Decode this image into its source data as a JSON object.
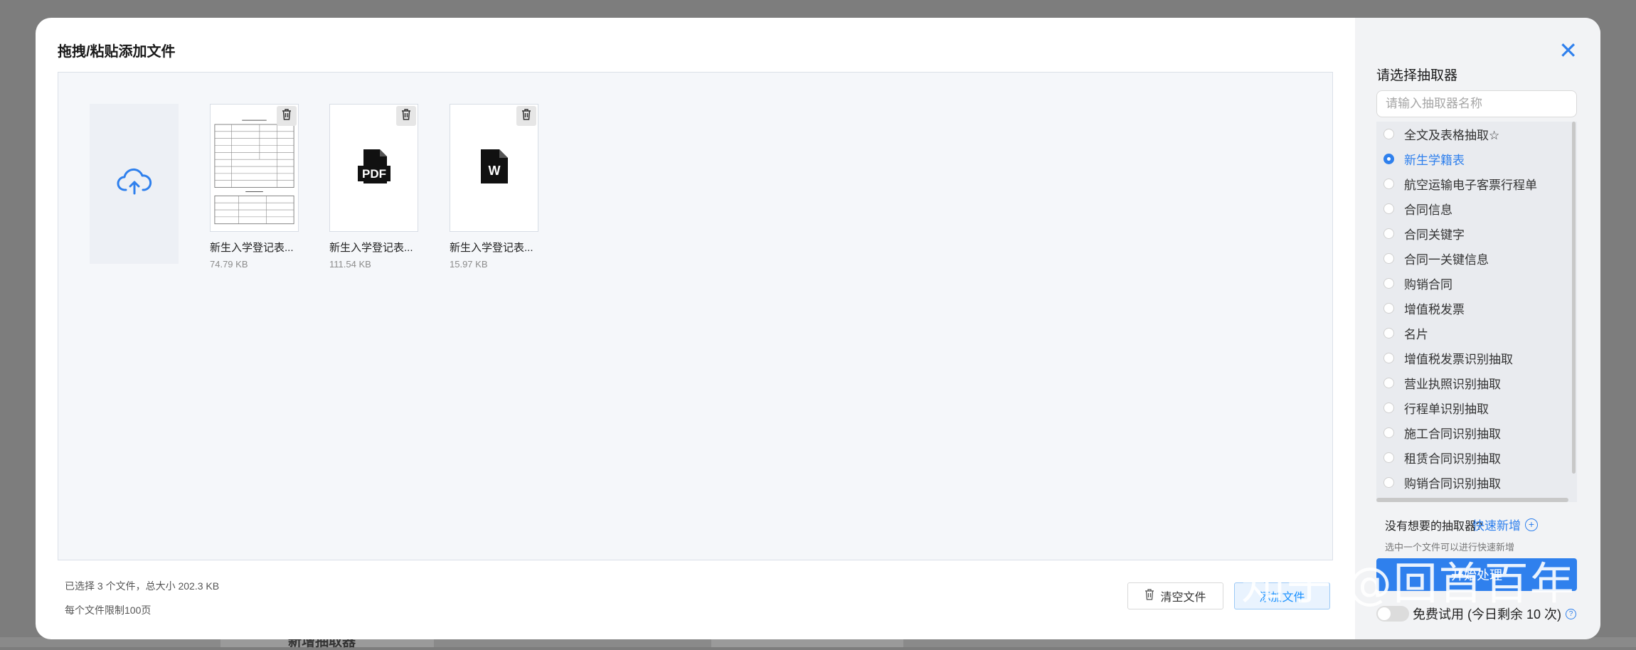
{
  "modal": {
    "title": "拖拽/粘贴添加文件"
  },
  "files": [
    {
      "name": "新生入学登记表...",
      "size": "74.79 KB",
      "type": "image"
    },
    {
      "name": "新生入学登记表...",
      "size": "111.54 KB",
      "type": "pdf",
      "badge": "PDF"
    },
    {
      "name": "新生入学登记表...",
      "size": "15.97 KB",
      "type": "word",
      "badge": "W"
    }
  ],
  "footer": {
    "summary": "已选择 3 个文件，总大小 202.3 KB",
    "limit": "每个文件限制100页",
    "clear_label": "清空文件",
    "add_label": "添加文件"
  },
  "panel": {
    "title": "请选择抽取器",
    "search_placeholder": "请输入抽取器名称",
    "items": [
      {
        "label": "全文及表格抽取☆",
        "selected": false
      },
      {
        "label": "新生学籍表",
        "selected": true
      },
      {
        "label": "航空运输电子客票行程单",
        "selected": false
      },
      {
        "label": "合同信息",
        "selected": false
      },
      {
        "label": "合同关键字",
        "selected": false
      },
      {
        "label": "合同一关键信息",
        "selected": false
      },
      {
        "label": "购销合同",
        "selected": false
      },
      {
        "label": "增值税发票",
        "selected": false
      },
      {
        "label": "名片",
        "selected": false
      },
      {
        "label": "增值税发票识别抽取",
        "selected": false
      },
      {
        "label": "营业执照识别抽取",
        "selected": false
      },
      {
        "label": "行程单识别抽取",
        "selected": false
      },
      {
        "label": "施工合同识别抽取",
        "selected": false
      },
      {
        "label": "租赁合同识别抽取",
        "selected": false
      },
      {
        "label": "购销合同识别抽取",
        "selected": false
      }
    ],
    "no_want": "没有想要的抽取器?",
    "quick_add": "快速新增",
    "hint": "选中一个文件可以进行快速新增",
    "start_label": "开始处理",
    "trial_label": "免费试用 (今日剩余 10 次)"
  },
  "background": {
    "partial_text": "新增抽取器"
  },
  "watermark": "知乎 @回首百年",
  "colors": {
    "accent": "#2f80ed",
    "overlay": "#7d7d7d"
  },
  "icons": [
    "upload-cloud-icon",
    "trash-icon",
    "pdf-file-icon",
    "word-file-icon",
    "close-icon",
    "plus-circle-icon",
    "help-icon"
  ]
}
